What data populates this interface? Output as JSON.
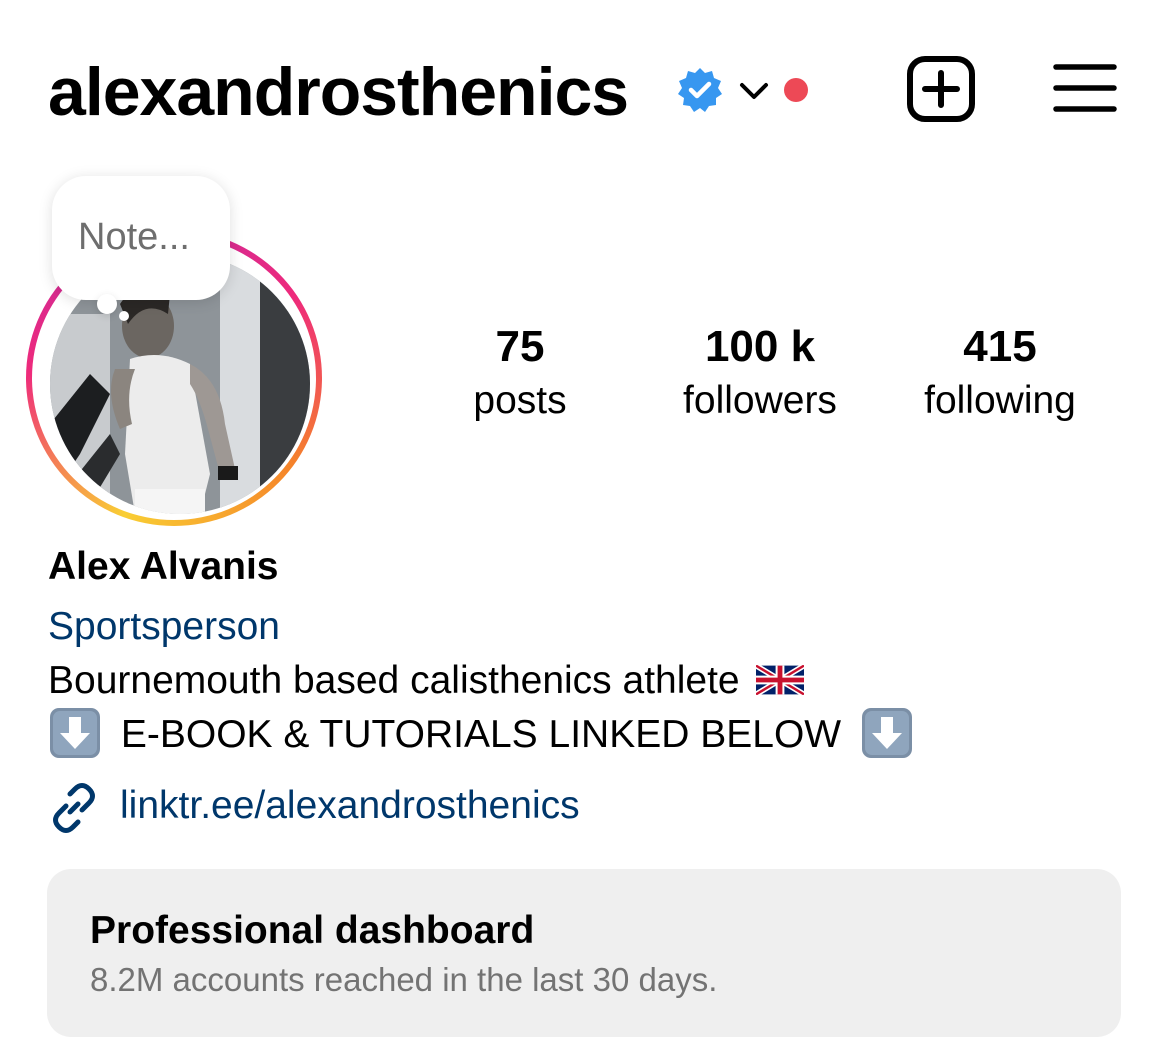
{
  "header": {
    "username": "alexandrosthenics",
    "verified_icon": "verified-badge-icon",
    "account_switch_icon": "chevron-down-icon",
    "notification_dot_color": "#ed4956",
    "new_post_icon": "plus-square-icon",
    "menu_icon": "hamburger-menu-icon"
  },
  "note": {
    "placeholder": "Note..."
  },
  "stats": [
    {
      "number": "75",
      "label": "posts"
    },
    {
      "number": "100 k",
      "label": "followers"
    },
    {
      "number": "415",
      "label": "following"
    }
  ],
  "profile": {
    "display_name": "Alex Alvanis",
    "category": "Sportsperson",
    "bio_line_1": "Bournemouth based calisthenics athlete",
    "bio_line_1_emoji": "uk-flag-icon",
    "bio_line_2": "E-BOOK & TUTORIALS LINKED BELOW",
    "bio_line_2_emoji": "down-arrow-emoji-icon",
    "link_icon": "link-icon",
    "link": "linktr.ee/alexandrosthenics"
  },
  "dashboard": {
    "title": "Professional dashboard",
    "subtitle": "8.2M accounts reached in the last 30 days."
  },
  "colors": {
    "link_blue": "#00376b",
    "verified_blue": "#3797f0",
    "dashboard_bg": "#efefef",
    "secondary_text": "#737373",
    "story_ring": [
      "#f9ce34",
      "#ee2a7b",
      "#c32aa3"
    ]
  }
}
